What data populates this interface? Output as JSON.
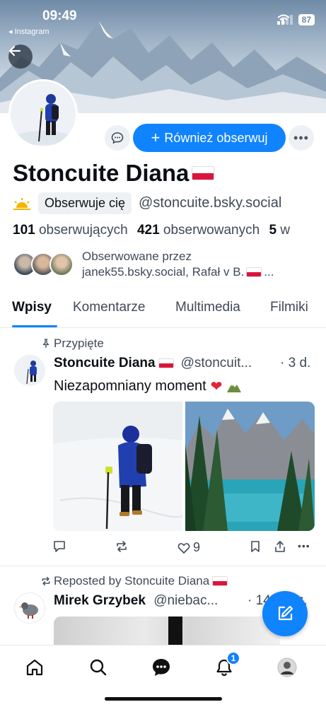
{
  "status_bar": {
    "time": "09:49",
    "back_app": "◂ Instagram",
    "battery": "87"
  },
  "profile": {
    "display_name": "Stoncuite Diana",
    "follows_you_badge": "Obserwuje cię",
    "handle": "@stoncuite.bsky.social",
    "followers_count": "101",
    "followers_label": "obserwujących",
    "following_count": "421",
    "following_label": "obserwowanych",
    "posts_count": "5",
    "posts_label": "w",
    "followed_by_title": "Obserwowane przez",
    "followed_by_names": "janek55.bsky.social, Rafał v B.",
    "followed_by_ellipsis": "..."
  },
  "actions": {
    "follow_back_label": "Również obserwuj"
  },
  "tabs": [
    {
      "label": "Wpisy",
      "active": true
    },
    {
      "label": "Komentarze",
      "active": false
    },
    {
      "label": "Multimedia",
      "active": false
    },
    {
      "label": "Filmiki",
      "active": false
    }
  ],
  "posts": [
    {
      "context": "Przypięte",
      "author": "Stoncuite Diana",
      "handle": "@stoncuit...",
      "time": "· 3 d.",
      "text": "Niezapomniany moment",
      "like_count": "9"
    },
    {
      "context": "Reposted by Stoncuite Diana",
      "author": "Mirek Grzybek",
      "handle": "@niebac...",
      "time": "· 14 godz."
    }
  ],
  "bottom_nav": {
    "notifications_badge": "1"
  },
  "colors": {
    "accent": "#1083fe",
    "text": "#0b0f14",
    "muted": "#3f4a57",
    "surface": "#eef1f4"
  },
  "icons": [
    "back-arrow-icon",
    "chat-icon",
    "plus-icon",
    "more-icon",
    "sun-icon",
    "pin-icon",
    "comment-icon",
    "repost-icon",
    "heart-icon",
    "bookmark-icon",
    "share-icon",
    "compose-icon",
    "home-icon",
    "search-icon",
    "messages-icon",
    "bell-icon"
  ]
}
